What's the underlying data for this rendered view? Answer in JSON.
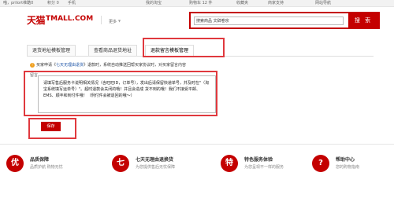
{
  "topbar": {
    "greeting": "喵，",
    "username": "prilort维酷0",
    "points": "积分 0",
    "mobile": "手机",
    "my_taobao": "我的淘宝",
    "cart": "购物车 12 件",
    "favorites": "收藏夹",
    "seller_center": "商家支持",
    "site_nav": "网站导航"
  },
  "header": {
    "logo_cn": "天猫",
    "logo_en": "TMALL.COM",
    "sub_link": "更多"
  },
  "search": {
    "value": "搜索商品 文辞卷宗",
    "button": "搜 索"
  },
  "tabs": [
    {
      "label": "退货地址模板管理"
    },
    {
      "label": "查看商品退货地址"
    },
    {
      "label": "退款留言模板管理"
    }
  ],
  "notice": {
    "prefix": "买家申请《",
    "link": "七天无理由退货",
    "suffix": "》退款时，系统自动推送回帮买家协议时，对买家留言内容"
  },
  "form": {
    "label": "留言",
    "message": "请填写售后服务卡说明相关情况（含旺旺ID，订单号），发出后请保留快递单号，并及时在\"（淘宝系统填写运单号）\"。超时退款会关闭的哦！并且会造成 货不到的哦！我们不接受平邮、EMS、顺丰和到付件哦！（例付件会被退回的哦～）",
    "save_label": "保存"
  },
  "services": [
    {
      "icon": "优",
      "title": "品质保障",
      "desc": "品质护航 购物无忧"
    },
    {
      "icon": "七",
      "title": "七天无理由退换货",
      "desc": "为您提供售后无忧保障"
    },
    {
      "icon": "特",
      "title": "特色服务体验",
      "desc": "为您呈现不一样的服务"
    },
    {
      "icon": "?",
      "title": "帮助中心",
      "desc": "您的购物指南"
    }
  ],
  "colors": {
    "brand": "#c40000",
    "highlight": "#e0393e",
    "link": "#1f56a8"
  }
}
